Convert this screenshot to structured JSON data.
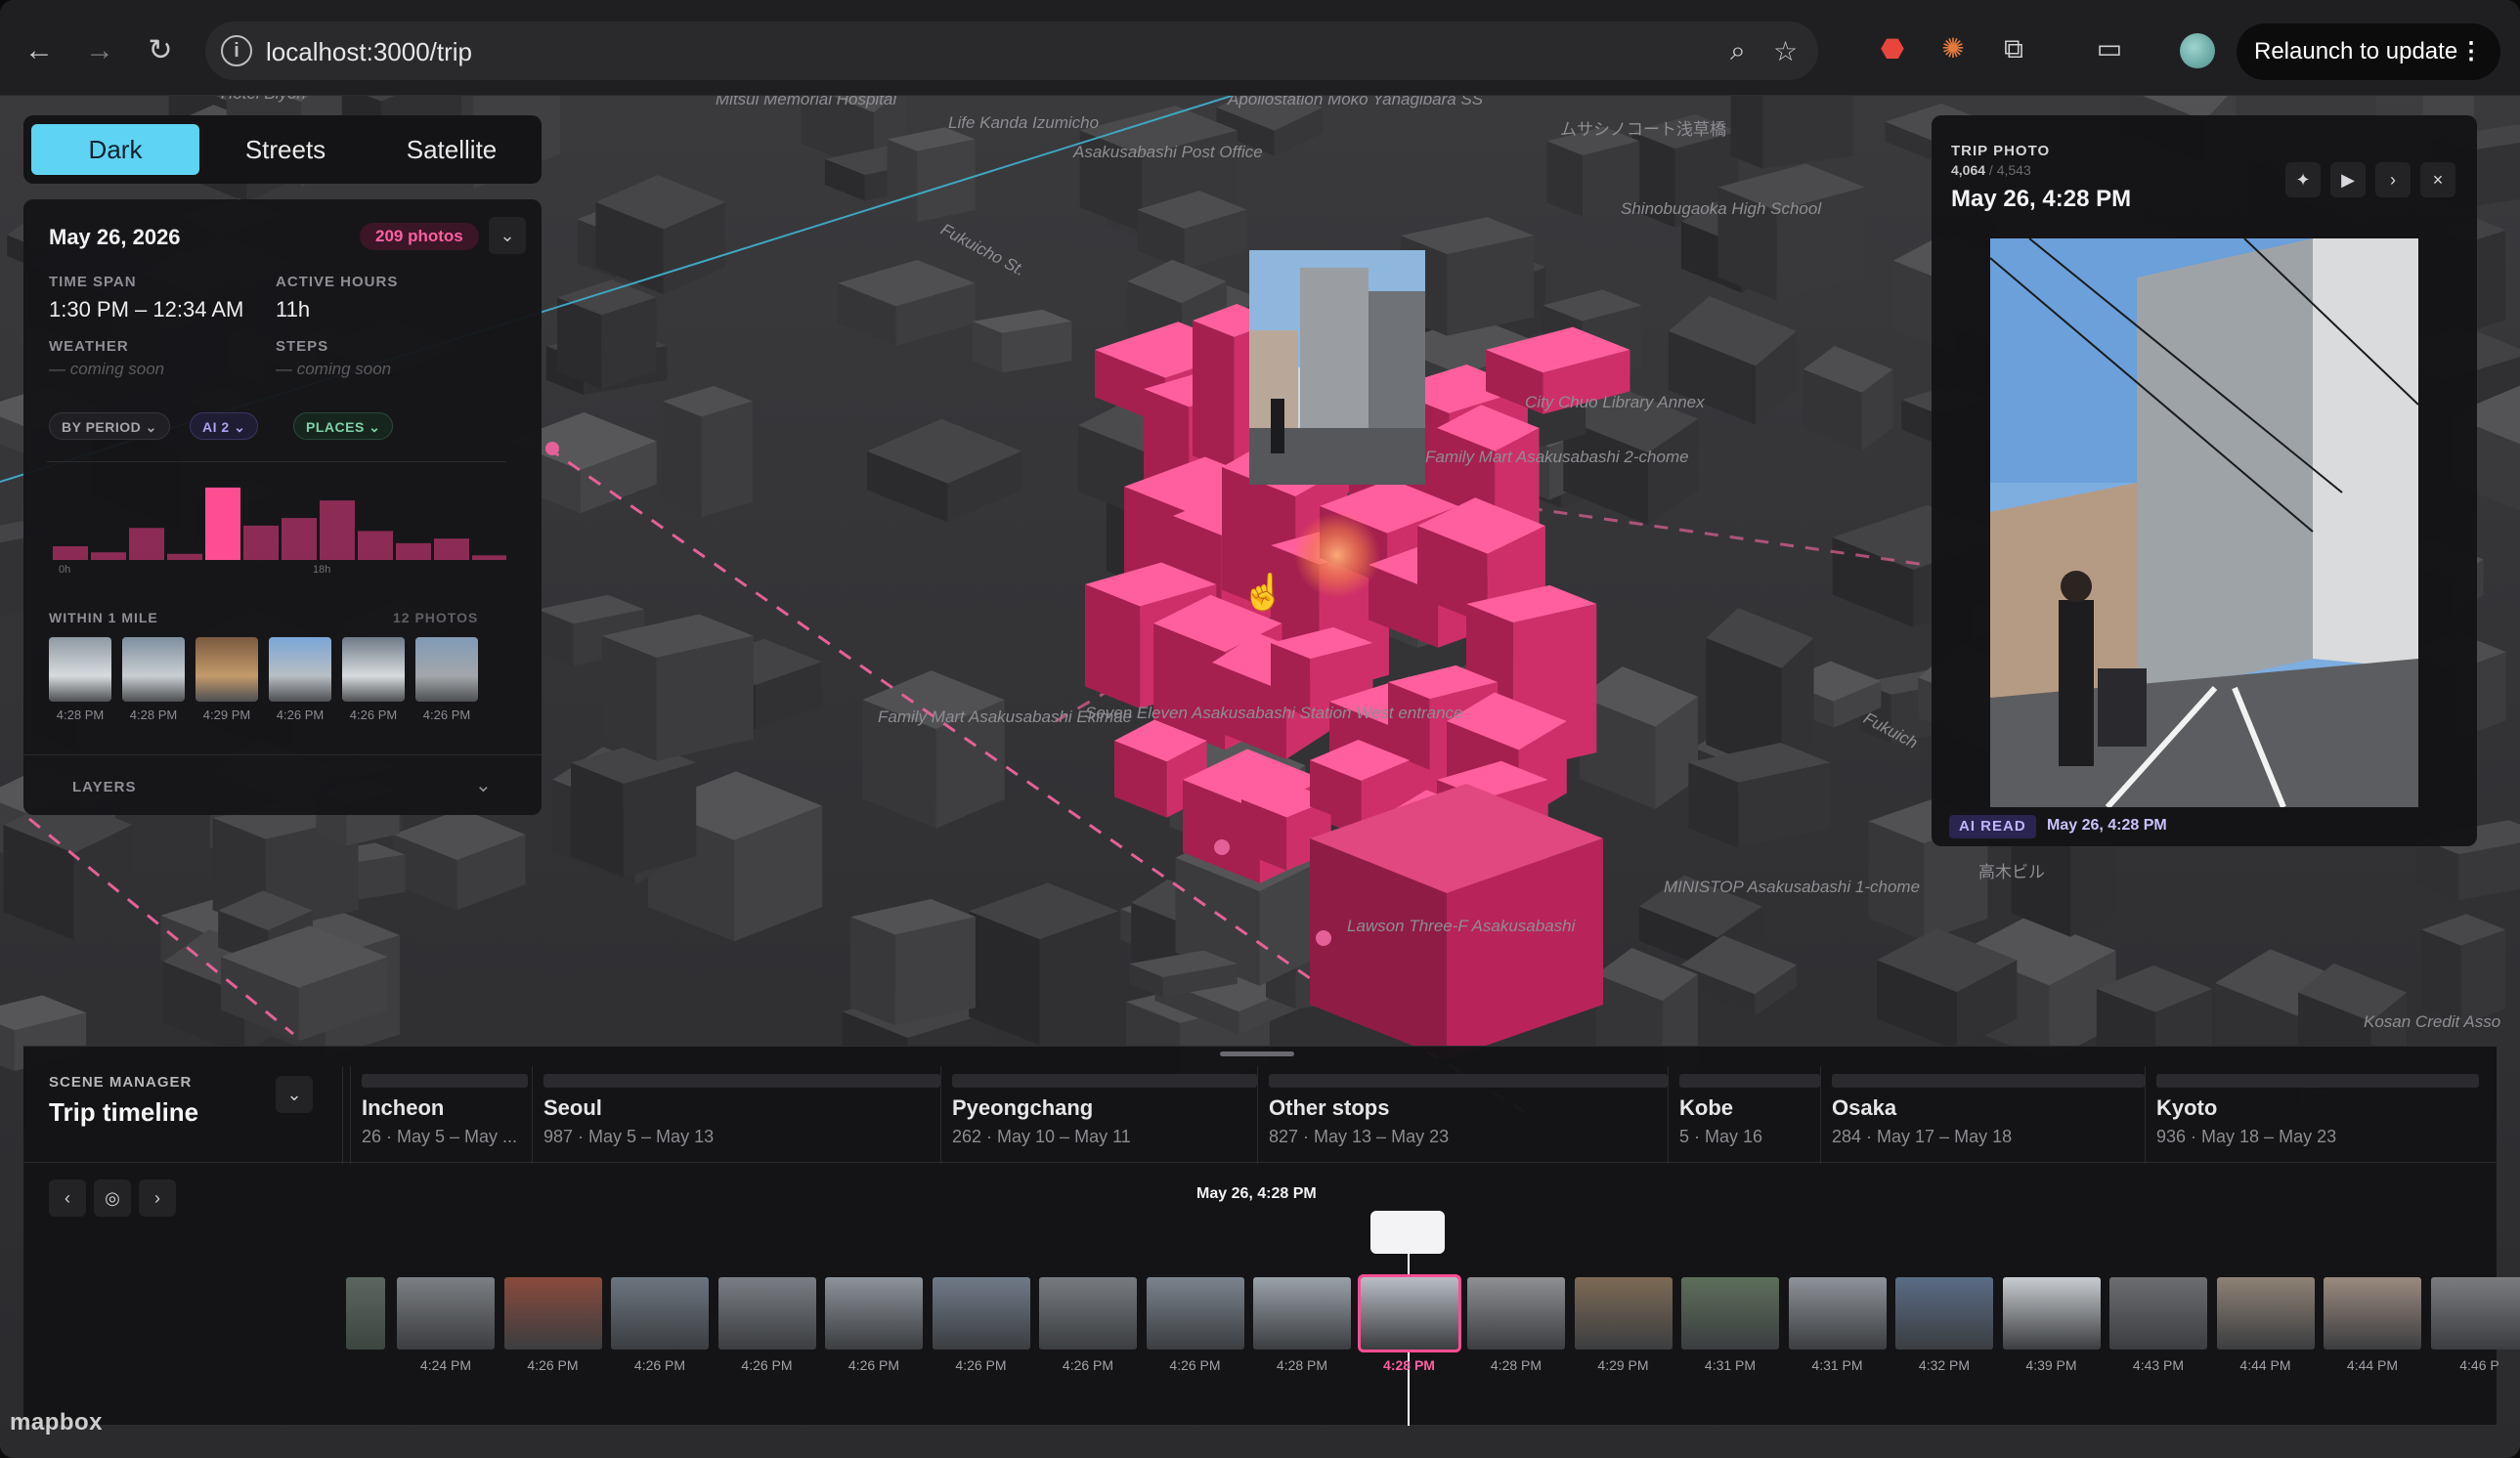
{
  "browser": {
    "url": "localhost:3000/trip",
    "relaunch_label": "Relaunch to update"
  },
  "map_style": {
    "options": [
      "Dark",
      "Streets",
      "Satellite"
    ],
    "selected": "Dark"
  },
  "map_labels": [
    "Mitsui Memorial Hospital",
    "Life Kanda Izumicho",
    "Asakusabashi Post Office",
    "Apollostation Moko Yanagibara SS",
    "ムサシノコート浅草橋",
    "Shinobugaoka High School",
    "Fukuicho St.",
    "City Chuo Library Annex",
    "Family Mart Asakusabashi 2-chome",
    "Family Mart Asakusabashi Ekimae",
    "Seven Eleven Asakusabashi Station West entrance",
    "MINISTOP Asakusabashi 1-chome",
    "Lawson Three-F Asakusabashi",
    "Fukuich",
    "高木ビル",
    "Kosan Credit Asso",
    "Hotel Biyori"
  ],
  "day_panel": {
    "date": "May 26, 2026",
    "photo_count": "209 photos",
    "time_span_label": "TIME SPAN",
    "time_span": "1:30 PM – 12:34 AM",
    "active_hours_label": "ACTIVE HOURS",
    "active_hours": "11h",
    "weather_label": "WEATHER",
    "weather_value": "— coming soon",
    "steps_label": "STEPS",
    "steps_value": "— coming soon",
    "filter_period": "BY PERIOD",
    "filter_ai": "AI",
    "filter_ai_count": "2",
    "filter_places": "PLACES",
    "histogram": [
      0.18,
      0.1,
      0.42,
      0.08,
      0.95,
      0.45,
      0.55,
      0.78,
      0.38,
      0.22,
      0.28,
      0.06
    ],
    "hist_start_label": "0h",
    "hist_mid_label": "18h",
    "nearby_label": "WITHIN 1 MILE",
    "nearby_count": "12 PHOTOS",
    "nearby_times": [
      "4:28 PM",
      "4:28 PM",
      "4:29 PM",
      "4:26 PM",
      "4:26 PM",
      "4:26 PM"
    ],
    "layers_label": "LAYERS"
  },
  "trip_photo": {
    "heading": "TRIP PHOTO",
    "index": "4,064",
    "total": "4,543",
    "timestamp": "May 26, 4:28 PM",
    "ai_badge": "AI READ",
    "caption_time": "May 26, 4:28 PM"
  },
  "scene_manager": {
    "heading": "SCENE MANAGER",
    "title": "Trip timeline",
    "segments": [
      {
        "name": "Incheon",
        "meta": "26 · May 5 – May ..."
      },
      {
        "name": "Seoul",
        "meta": "987 · May 5 – May 13"
      },
      {
        "name": "Pyeongchang",
        "meta": "262 · May 10 – May 11"
      },
      {
        "name": "Other stops",
        "meta": "827 · May 13 – May 23"
      },
      {
        "name": "Kobe",
        "meta": "5 · May 16"
      },
      {
        "name": "Osaka",
        "meta": "284 · May 17 – May 18"
      },
      {
        "name": "Kyoto",
        "meta": "936 · May 18 – May 23"
      }
    ],
    "cursor_label": "May 26, 4:28 PM",
    "film_times": [
      "4:24 PM",
      "4:26 PM",
      "4:26 PM",
      "4:26 PM",
      "4:26 PM",
      "4:26 PM",
      "4:26 PM",
      "4:26 PM",
      "4:28 PM",
      "4:28 PM",
      "4:28 PM",
      "4:29 PM",
      "4:31 PM",
      "4:31 PM",
      "4:32 PM",
      "4:39 PM",
      "4:43 PM",
      "4:44 PM",
      "4:44 PM",
      "4:46 P"
    ],
    "current_index": 9
  },
  "attribution": "mapbox",
  "colors": {
    "accent": "#5fd3f3",
    "pink": "#e0336f",
    "violet": "#a9a2ee"
  }
}
